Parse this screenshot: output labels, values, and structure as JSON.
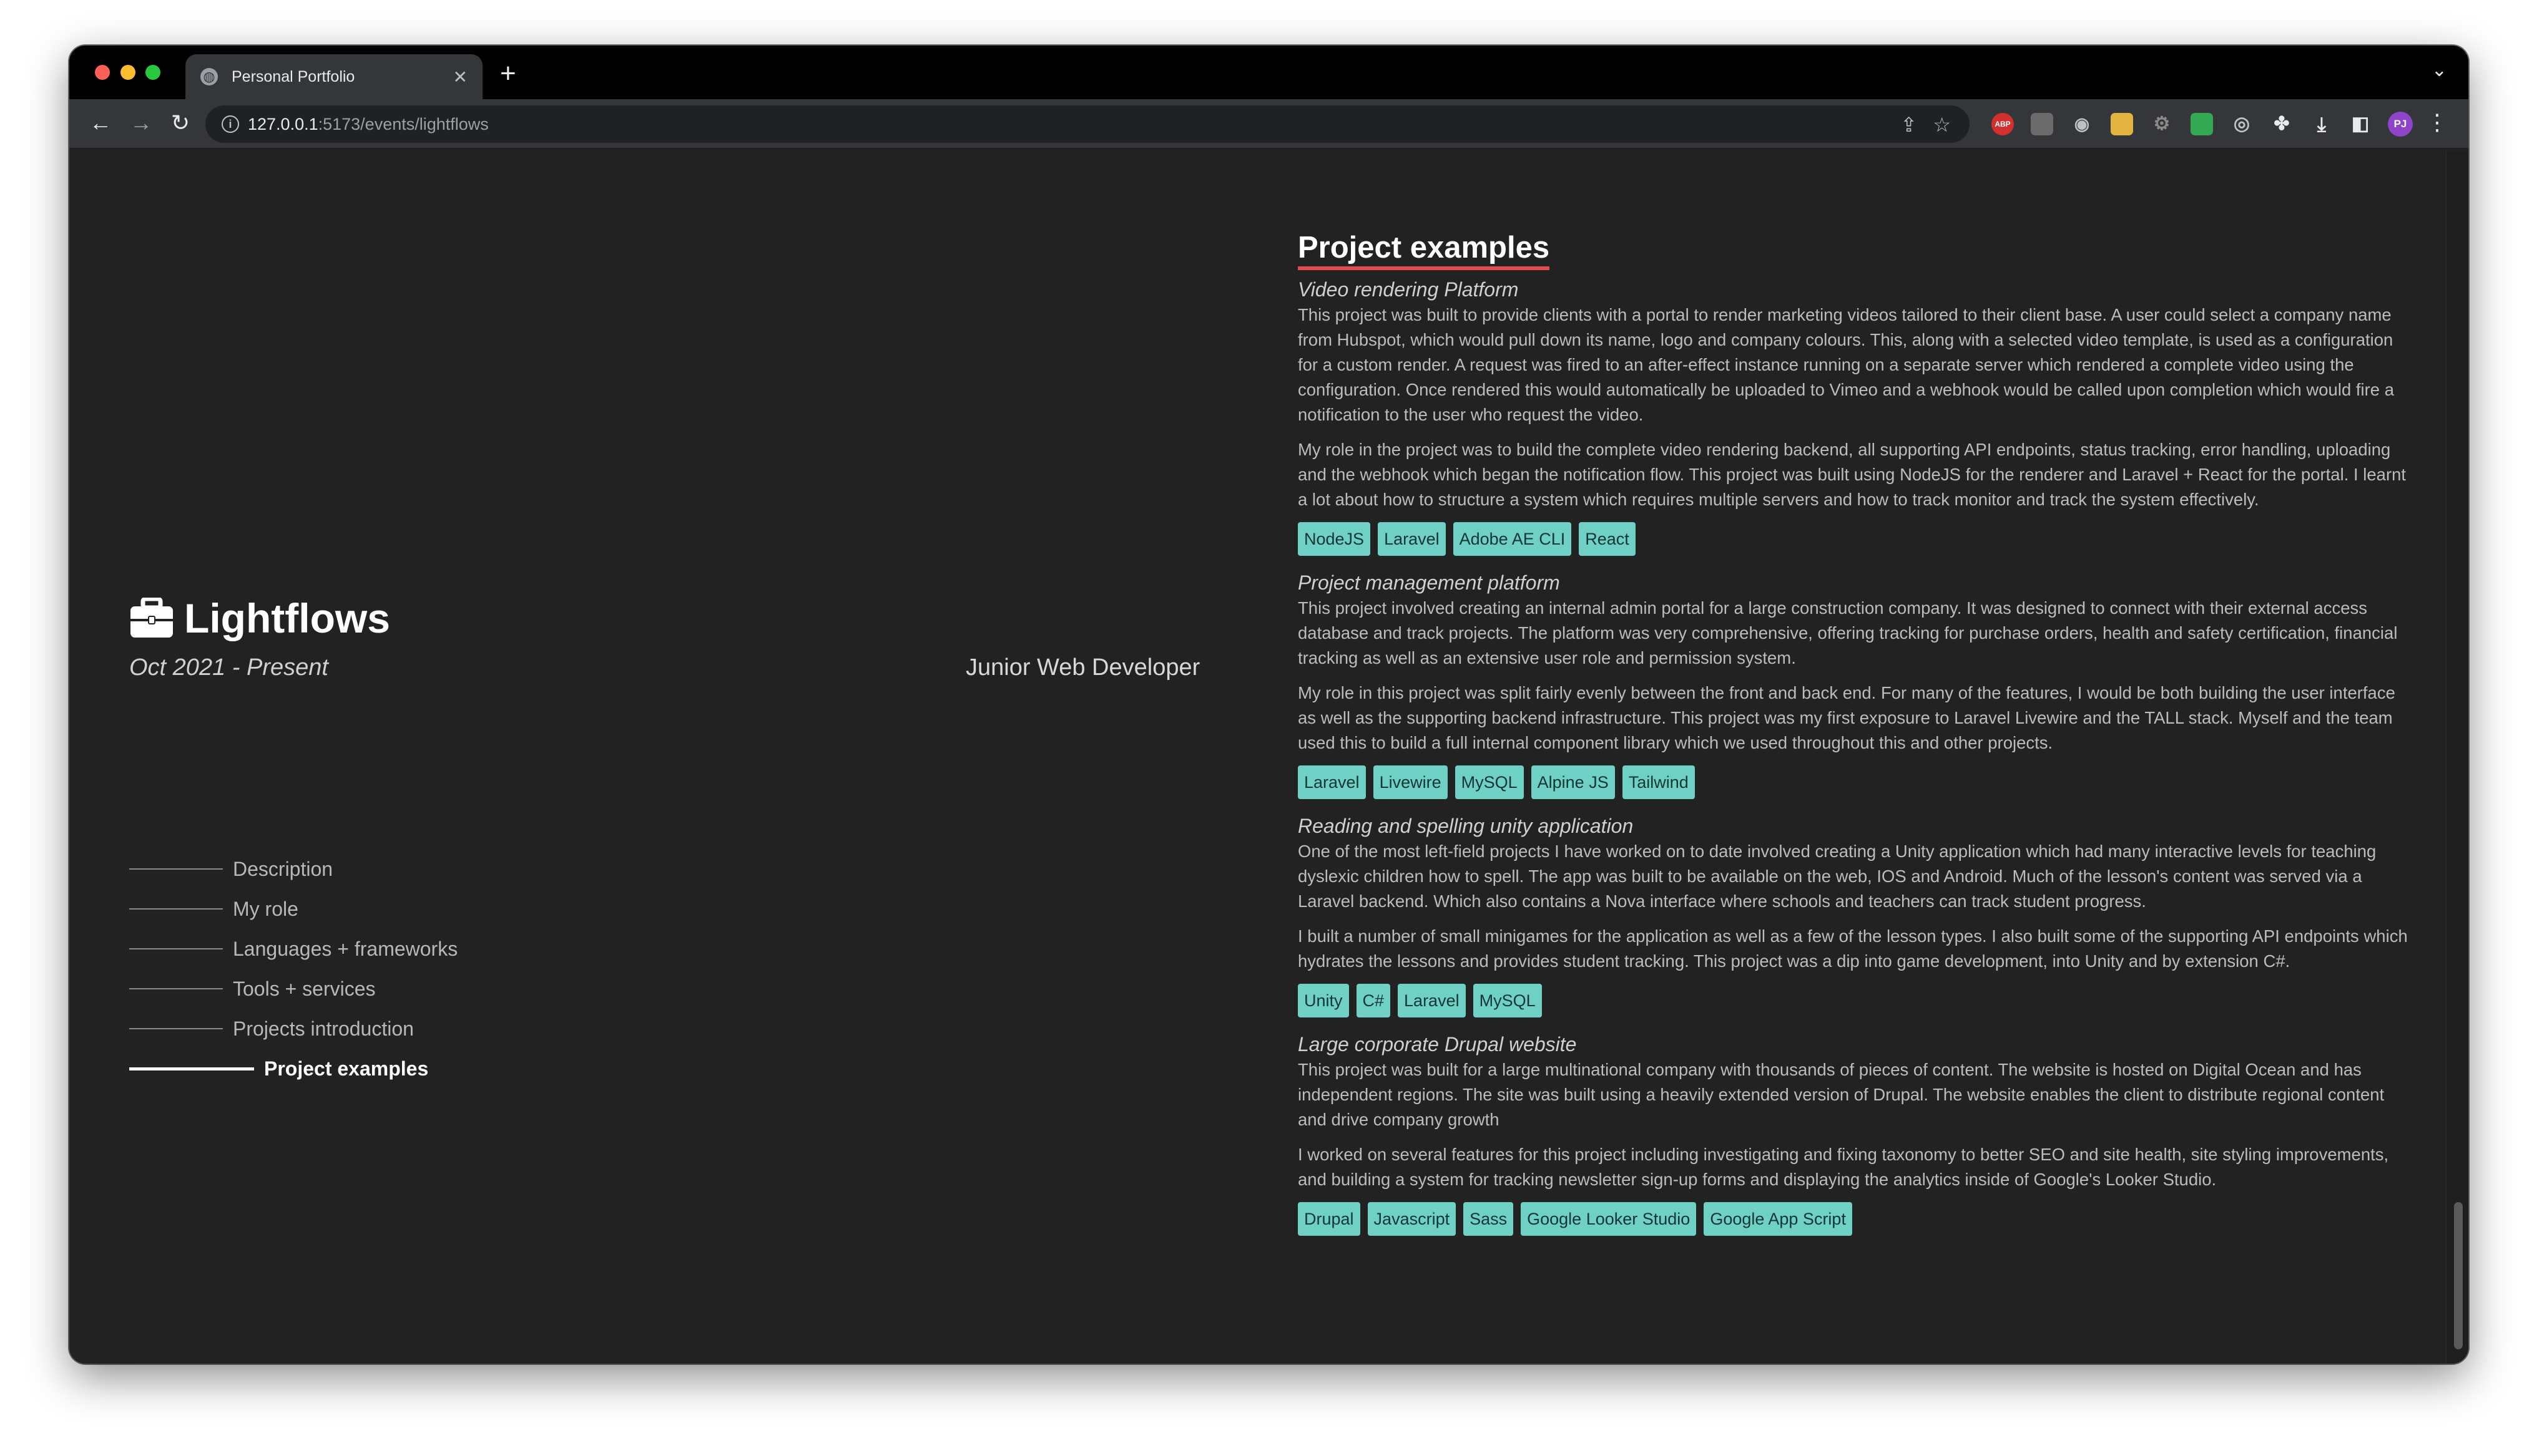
{
  "browser": {
    "tab_title": "Personal Portfolio",
    "url_host": "127.0.0.1",
    "url_rest": ":5173/events/lightflows",
    "profile_initials": "PJ",
    "ext_abp": "ABP"
  },
  "company": {
    "name": "Lightflows",
    "dates": "Oct 2021 - Present",
    "job_title": "Junior Web Developer"
  },
  "nav": {
    "items": [
      {
        "label": "Description"
      },
      {
        "label": "My role"
      },
      {
        "label": "Languages + frameworks"
      },
      {
        "label": "Tools + services"
      },
      {
        "label": "Projects introduction"
      },
      {
        "label": "Project examples"
      }
    ]
  },
  "section": {
    "heading": "Project examples"
  },
  "projects": [
    {
      "title": "Video rendering Platform",
      "paragraphs": [
        "This project was built to provide clients with a portal to render marketing videos tailored to their client base. A user could select a company name from Hubspot, which would pull down its name, logo and company colours. This, along with a selected video template, is used as a configuration for a custom render. A request was fired to an after-effect instance running on a separate server which rendered a complete video using the configuration. Once rendered this would automatically be uploaded to Vimeo and a webhook would be called upon completion which would fire a notification to the user who request the video.",
        "My role in the project was to build the complete video rendering backend, all supporting API endpoints, status tracking, error handling, uploading and the webhook which began the notification flow. This project was built using NodeJS for the renderer and Laravel + React for the portal. I learnt a lot about how to structure a system which requires multiple servers and how to track monitor and track the system effectively."
      ],
      "tags": [
        "NodeJS",
        "Laravel",
        "Adobe AE CLI",
        "React"
      ]
    },
    {
      "title": "Project management platform",
      "paragraphs": [
        "This project involved creating an internal admin portal for a large construction company. It was designed to connect with their external access database and track projects. The platform was very comprehensive, offering tracking for purchase orders, health and safety certification, financial tracking as well as an extensive user role and permission system.",
        "My role in this project was split fairly evenly between the front and back end. For many of the features, I would be both building the user interface as well as the supporting backend infrastructure. This project was my first exposure to Laravel Livewire and the TALL stack. Myself and the team used this to build a full internal component library which we used throughout this and other projects."
      ],
      "tags": [
        "Laravel",
        "Livewire",
        "MySQL",
        "Alpine JS",
        "Tailwind"
      ]
    },
    {
      "title": "Reading and spelling unity application",
      "paragraphs": [
        "One of the most left-field projects I have worked on to date involved creating a Unity application which had many interactive levels for teaching dyslexic children how to spell. The app was built to be available on the web, IOS and Android. Much of the lesson's content was served via a Laravel backend. Which also contains a Nova interface where schools and teachers can track student progress.",
        "I built a number of small minigames for the application as well as a few of the lesson types. I also built some of the supporting API endpoints which hydrates the lessons and provides student tracking. This project was a dip into game development, into Unity and by extension C#."
      ],
      "tags": [
        "Unity",
        "C#",
        "Laravel",
        "MySQL"
      ]
    },
    {
      "title": "Large corporate Drupal website",
      "paragraphs": [
        "This project was built for a large multinational company with thousands of pieces of content. The website is hosted on Digital Ocean and has independent regions. The site was built using a heavily extended version of Drupal. The website enables the client to distribute regional content and drive company growth",
        "I worked on several features for this project including investigating and fixing taxonomy to better SEO and site health, site styling improvements, and building a system for tracking newsletter sign-up forms and displaying the analytics inside of Google's Looker Studio."
      ],
      "tags": [
        "Drupal",
        "Javascript",
        "Sass",
        "Google Looker Studio",
        "Google App Script"
      ]
    }
  ]
}
